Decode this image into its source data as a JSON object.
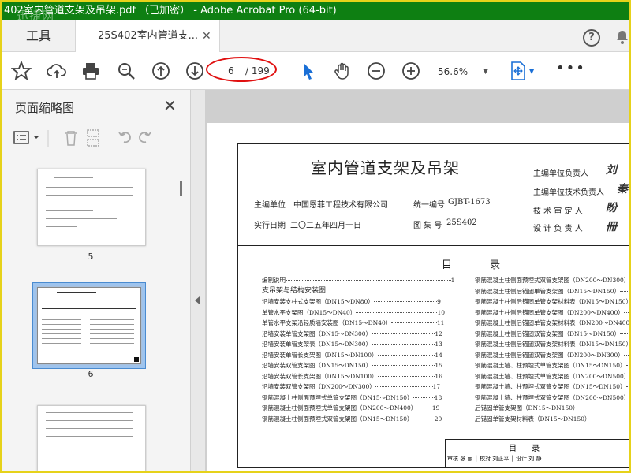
{
  "window": {
    "title": "402室内管道支架及吊架.pdf （已加密） - Adobe Acrobat Pro (64-bit)",
    "watermark": "迅捷网"
  },
  "tabs": {
    "tools": "工具",
    "doc": "25S402室内管道支..."
  },
  "toolbar": {
    "page_current": "6",
    "page_total": "/ 199",
    "zoom": "56.6%",
    "more": "•••"
  },
  "sidebar": {
    "title": "页面缩略图",
    "thumbs": [
      {
        "num": "5"
      },
      {
        "num": "6"
      }
    ]
  },
  "page": {
    "title": "室内管道支架及吊架",
    "org_label": "主编单位",
    "org": "中国恩菲工程技术有限公司",
    "serial_label": "统一编号",
    "serial": "GJBT-1673",
    "date_label": "实行日期",
    "date": "二〇二五年四月一日",
    "set_label": "图 集 号",
    "set": "25S402",
    "roles": [
      "主编单位负责人",
      "主编单位技术负责人",
      "技 术 审 定 人",
      "设 计 负 责 人"
    ],
    "signatures": [
      "刘",
      "秦",
      "盼",
      "冊"
    ],
    "toc_title": "目 录",
    "toc_left": [
      {
        "text": "编制说明",
        "page": "1"
      },
      {
        "text": "支吊架与结构安装图",
        "page": "",
        "section": true
      },
      {
        "text": "沿墙安装支柱式支架图（DN15～DN80）",
        "page": "9"
      },
      {
        "text": "单管水平支架图（DN15～DN40）",
        "page": "10"
      },
      {
        "text": "单管水平支架沿轻质墙安装图（DN15～DN40）",
        "page": "11"
      },
      {
        "text": "沿墙安装单管支架图（DN15～DN300）",
        "page": "12"
      },
      {
        "text": "沿墙安装单管支架表（DN15～DN300）",
        "page": "13"
      },
      {
        "text": "沿墙安装单管长支架图（DN15～DN100）",
        "page": "14"
      },
      {
        "text": "沿墙安装双管支架图（DN15～DN150）",
        "page": "15"
      },
      {
        "text": "沿墙安装双管长支架图（DN15～DN100）",
        "page": "16"
      },
      {
        "text": "沿墙安装双管支架图（DN200～DN300）",
        "page": "17"
      },
      {
        "text": "钢筋混凝土柱侧面预埋式单管支架图（DN15～DN150）",
        "page": "18"
      },
      {
        "text": "钢筋混凝土柱侧面预埋式单管支架图（DN200～DN400）",
        "page": "19"
      },
      {
        "text": "钢筋混凝土柱侧面预埋式双管支架图（DN15～DN150）",
        "page": "20"
      }
    ],
    "toc_right": [
      "钢筋混凝土柱侧面预埋式双管支架图（DN200～DN300）",
      "钢筋混凝土柱侧后锚固单管支架图（DN15～DN150）",
      "钢筋混凝土柱侧后锚固单管支架材料表（DN15～DN150）",
      "钢筋混凝土柱侧后锚固单管支架图（DN200～DN400）",
      "钢筋混凝土柱侧后锚固单管支架材料表（DN200～DN400）",
      "钢筋混凝土柱侧后锚固双管支架图（DN15～DN150）",
      "钢筋混凝土柱侧后锚固双管支架材料表（DN15～DN150）",
      "钢筋混凝土柱侧后锚固双管支架图（DN200～DN300）",
      "钢筋混凝土墙、柱预埋式单管支架图（DN15～DN150）",
      "钢筋混凝土墙、柱预埋式单管支架图（DN200～DN500）",
      "钢筋混凝土墙、柱预埋式双管支架图（DN15～DN150）",
      "钢筋混凝土墙、柱预埋式双管支架图（DN200～DN500）",
      "后锚固单管支架图（DN15～DN150）",
      "后锚固单管支架材料表（DN15～DN150）"
    ],
    "bottom_title": "目 录",
    "bottom_cells": "审核 张 丽 │ 校对 刘正平 │ 设计 刘 静"
  },
  "colors": {
    "titlebar": "#0e7f12",
    "frame": "#e6d21a",
    "highlight_oval": "#e01010",
    "cursor_blue": "#1a6fd6"
  }
}
